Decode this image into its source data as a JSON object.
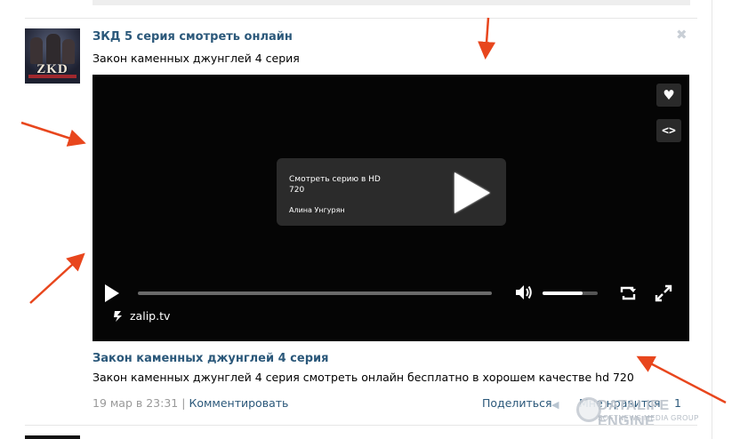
{
  "post": {
    "title": "ЗКД 5 серия смотреть онлайн",
    "subtitle": "Закон каменных джунглей 4 серия",
    "avatar_caption": "ZKD",
    "close_glyph": "✖"
  },
  "player": {
    "card_title": "Смотреть серию в HD 720",
    "card_author": "Алина Унгурян",
    "brand": "zalip.tv",
    "volume_level": 0.72,
    "progress": 0,
    "icons": [
      "heart-icon",
      "embed-code-icon",
      "play-icon",
      "volume-icon",
      "loop-icon",
      "fullscreen-icon"
    ]
  },
  "attachment": {
    "title": "Закон каменных джунглей 4 серия",
    "description": "Закон каменных джунглей 4 серия смотреть онлайн бесплатно в хорошем качестве hd 720"
  },
  "meta": {
    "date": "19 мар в 23:31",
    "separator": "|",
    "comment": "Комментировать",
    "share": "Поделиться",
    "like": "Мне нравится",
    "like_count": "1"
  },
  "watermark": {
    "text": "DATALIFE ENGINE",
    "subtext": "SOFTNEWS MEDIA GROUP"
  },
  "colors": {
    "link": "#2b587a",
    "arrow": "#e8461d",
    "player_bg": "#050505"
  }
}
